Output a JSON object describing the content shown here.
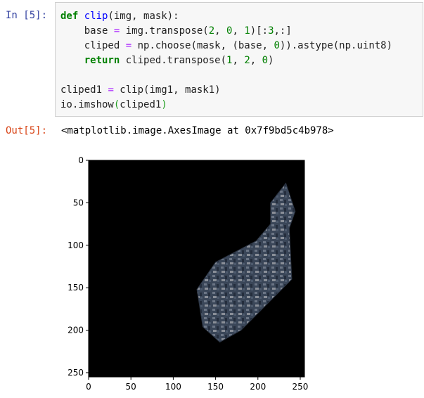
{
  "input_cell": {
    "prompt": "In [5]:",
    "code_lines": [
      [
        {
          "t": "def",
          "c": "kw"
        },
        {
          "t": " "
        },
        {
          "t": "clip",
          "c": "fn"
        },
        {
          "t": "(img, mask):"
        }
      ],
      [
        {
          "t": "    base "
        },
        {
          "t": "=",
          "c": "op"
        },
        {
          "t": " img.transpose("
        },
        {
          "t": "2",
          "c": "num"
        },
        {
          "t": ", "
        },
        {
          "t": "0",
          "c": "num"
        },
        {
          "t": ", "
        },
        {
          "t": "1",
          "c": "num"
        },
        {
          "t": ")[:"
        },
        {
          "t": "3",
          "c": "num"
        },
        {
          "t": ",:]"
        }
      ],
      [
        {
          "t": "    cliped "
        },
        {
          "t": "=",
          "c": "op"
        },
        {
          "t": " np.choose(mask, (base, "
        },
        {
          "t": "0",
          "c": "num"
        },
        {
          "t": ")).astype(np.uint8)"
        }
      ],
      [
        {
          "t": "    "
        },
        {
          "t": "return",
          "c": "kw"
        },
        {
          "t": " cliped.transpose("
        },
        {
          "t": "1",
          "c": "num"
        },
        {
          "t": ", "
        },
        {
          "t": "2",
          "c": "num"
        },
        {
          "t": ", "
        },
        {
          "t": "0",
          "c": "num"
        },
        {
          "t": ")"
        }
      ],
      [
        {
          "t": ""
        }
      ],
      [
        {
          "t": "cliped1 "
        },
        {
          "t": "=",
          "c": "op"
        },
        {
          "t": " clip(img1, mask1)"
        }
      ],
      [
        {
          "t": "io.imshow"
        },
        {
          "t": "(",
          "c": "paren"
        },
        {
          "t": "cliped1"
        },
        {
          "t": ")",
          "c": "paren"
        }
      ]
    ]
  },
  "output_cell": {
    "prompt": "Out[5]:",
    "text": "<matplotlib.image.AxesImage at 0x7f9bd5c4b978>"
  },
  "image_plot": {
    "x_ticks": [
      "0",
      "50",
      "100",
      "150",
      "200",
      "250"
    ],
    "y_ticks": [
      "0",
      "50",
      "100",
      "150",
      "200",
      "250"
    ]
  },
  "chart_data": {
    "type": "heatmap",
    "title": "",
    "xlabel": "",
    "ylabel": "",
    "xlim": [
      0,
      255
    ],
    "ylim": [
      255,
      0
    ],
    "x_ticks": [
      0,
      50,
      100,
      150,
      200,
      250
    ],
    "y_ticks": [
      0,
      50,
      100,
      150,
      200,
      250
    ],
    "background": "#000000",
    "clipped_region_outline": [
      [
        233,
        27
      ],
      [
        244,
        60
      ],
      [
        237,
        80
      ],
      [
        240,
        140
      ],
      [
        180,
        200
      ],
      [
        155,
        214
      ],
      [
        135,
        196
      ],
      [
        128,
        152
      ],
      [
        150,
        120
      ],
      [
        198,
        95
      ],
      [
        215,
        75
      ],
      [
        215,
        50
      ]
    ]
  }
}
